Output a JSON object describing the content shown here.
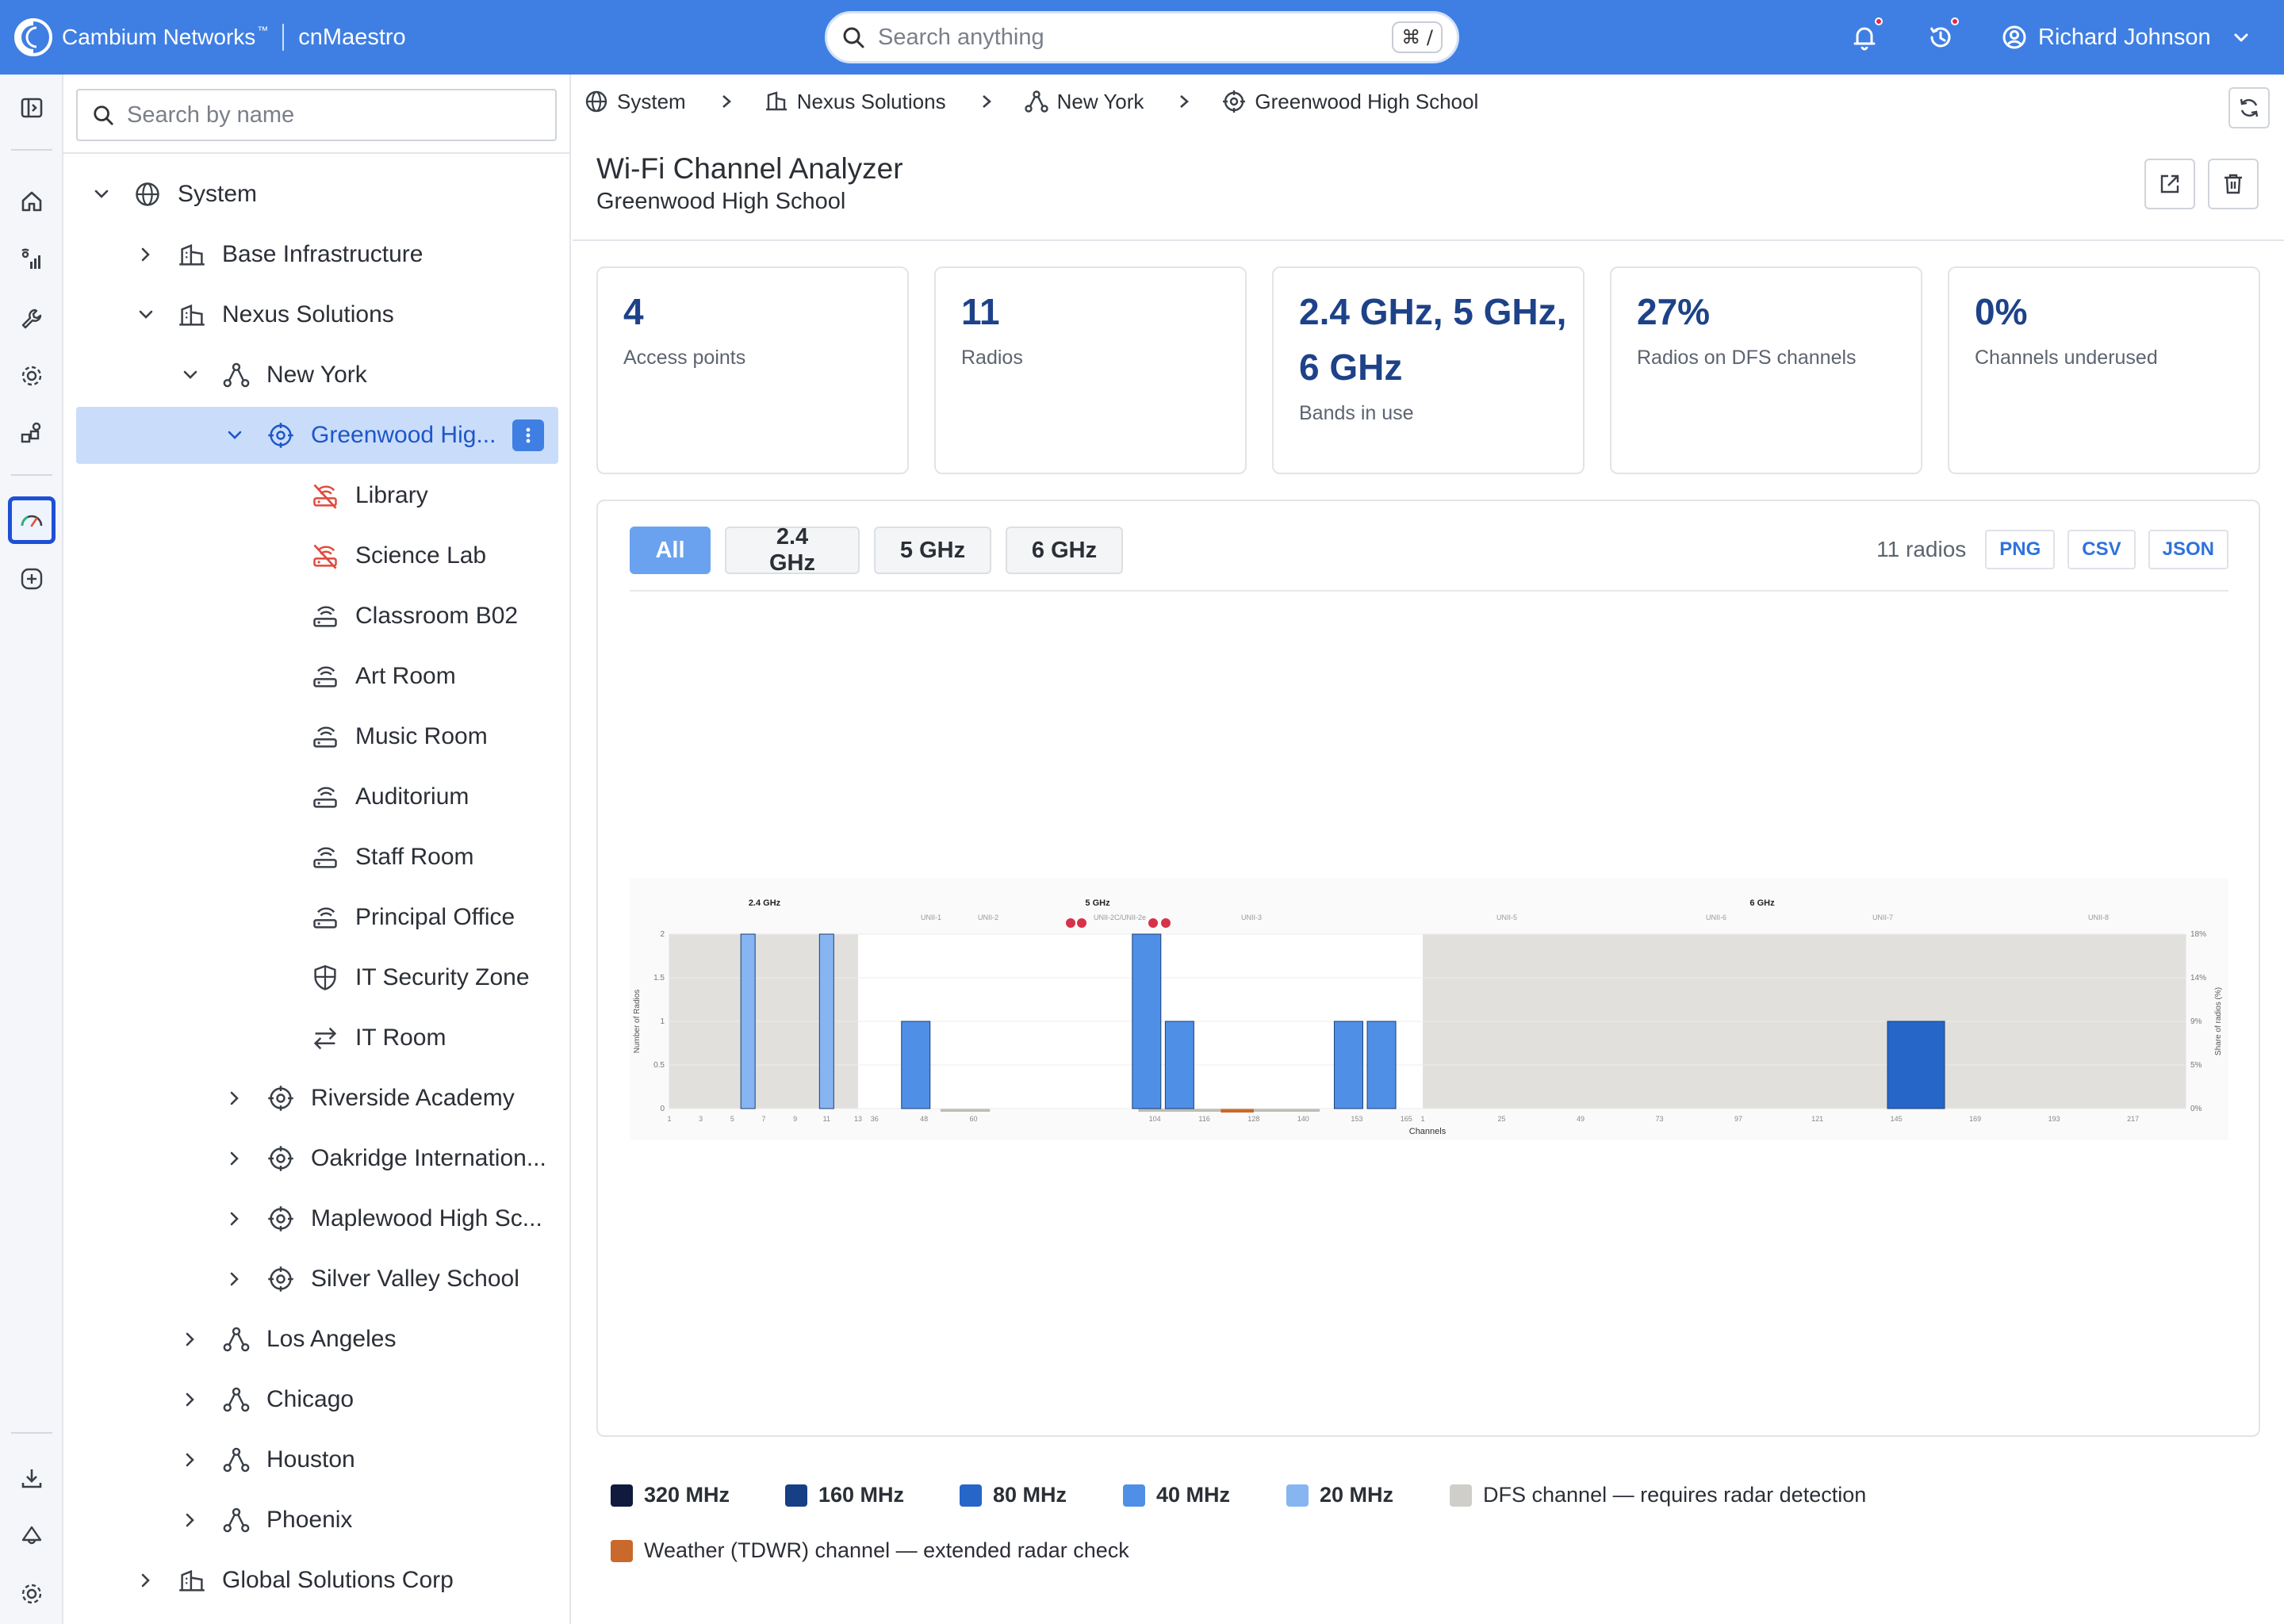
{
  "header": {
    "brand": "Cambium Networks",
    "brand_tm": "™",
    "product": "cnMaestro",
    "search_placeholder": "Search anything",
    "search_shortcut": "⌘ /",
    "user_name": "Richard Johnson"
  },
  "tree": {
    "search_placeholder": "Search by name",
    "nodes": [
      {
        "label": "System",
        "icon": "globe-icon"
      },
      {
        "label": "Base Infrastructure",
        "icon": "company-icon"
      },
      {
        "label": "Nexus Solutions",
        "icon": "company-icon"
      },
      {
        "label": "New York",
        "icon": "network-icon"
      },
      {
        "label": "Greenwood Hig...",
        "icon": "site-icon"
      },
      {
        "label": "Library",
        "icon": "ap-offline-icon"
      },
      {
        "label": "Science Lab",
        "icon": "ap-offline-icon"
      },
      {
        "label": "Classroom B02",
        "icon": "ap-icon"
      },
      {
        "label": "Art Room",
        "icon": "ap-icon"
      },
      {
        "label": "Music Room",
        "icon": "ap-icon"
      },
      {
        "label": "Auditorium",
        "icon": "ap-icon"
      },
      {
        "label": "Staff Room",
        "icon": "ap-icon"
      },
      {
        "label": "Principal Office",
        "icon": "ap-icon"
      },
      {
        "label": "IT Security Zone",
        "icon": "shield-icon"
      },
      {
        "label": "IT Room",
        "icon": "switch-icon"
      },
      {
        "label": "Riverside Academy",
        "icon": "site-icon"
      },
      {
        "label": "Oakridge Internation...",
        "icon": "site-icon"
      },
      {
        "label": "Maplewood High Sc...",
        "icon": "site-icon"
      },
      {
        "label": "Silver Valley School",
        "icon": "site-icon"
      },
      {
        "label": "Los Angeles",
        "icon": "network-icon"
      },
      {
        "label": "Chicago",
        "icon": "network-icon"
      },
      {
        "label": "Houston",
        "icon": "network-icon"
      },
      {
        "label": "Phoenix",
        "icon": "network-icon"
      },
      {
        "label": "Global Solutions Corp",
        "icon": "company-icon"
      }
    ]
  },
  "breadcrumb": [
    "System",
    "Nexus Solutions",
    "New York",
    "Greenwood High School"
  ],
  "page": {
    "title": "Wi-Fi Channel Analyzer",
    "subtitle": "Greenwood High School"
  },
  "kpis": [
    {
      "value": "4",
      "label": "Access points"
    },
    {
      "value": "11",
      "label": "Radios"
    },
    {
      "value": "2.4 GHz, 5 GHz, 6 GHz",
      "label": "Bands in use"
    },
    {
      "value": "27%",
      "label": "Radios on DFS channels"
    },
    {
      "value": "0%",
      "label": "Channels underused"
    }
  ],
  "chart_card": {
    "tabs": [
      "All",
      "2.4 GHz",
      "5 GHz",
      "6 GHz"
    ],
    "active_tab": "All",
    "radio_count": "11 radios",
    "exports": [
      "PNG",
      "CSV",
      "JSON"
    ]
  },
  "chart_data": {
    "type": "bar",
    "title": "",
    "xlabel": "Channels",
    "ylabel": "Number of Radios",
    "y2label": "Share of radios (%)",
    "ylim": [
      0,
      2
    ],
    "yticks": [
      "0",
      "0.5",
      "1",
      "1.5",
      "2"
    ],
    "y2ticks": [
      "0%",
      "5%",
      "9%",
      "14%",
      "18%"
    ],
    "bands": [
      {
        "name": "2.4 GHz",
        "sub": [],
        "ticks": [
          "1",
          "3",
          "5",
          "7",
          "9",
          "11",
          "13"
        ]
      },
      {
        "name": "5 GHz",
        "sub": [
          "UNII-1",
          "UNII-2",
          "UNII-2C/UNII-2e",
          "UNII-3"
        ],
        "ticks": [
          "36",
          "48",
          "60",
          "104",
          "116",
          "128",
          "140",
          "153",
          "165"
        ]
      },
      {
        "name": "6 GHz",
        "sub": [
          "UNII-5",
          "UNII-6",
          "UNII-7",
          "UNII-8"
        ],
        "ticks": [
          "1",
          "25",
          "49",
          "73",
          "97",
          "121",
          "145",
          "169",
          "193",
          "217"
        ]
      }
    ],
    "bars": [
      {
        "band": "2.4 GHz",
        "channel": 6,
        "width": "20 MHz",
        "count": 2
      },
      {
        "band": "2.4 GHz",
        "channel": 11,
        "width": "20 MHz",
        "count": 2
      },
      {
        "band": "5 GHz",
        "channel": 46,
        "width": "40 MHz",
        "count": 1
      },
      {
        "band": "5 GHz",
        "channel": 102,
        "width": "40 MHz",
        "count": 2
      },
      {
        "band": "5 GHz",
        "channel": 110,
        "width": "40 MHz",
        "count": 1
      },
      {
        "band": "5 GHz",
        "channel": 151,
        "width": "40 MHz",
        "count": 1
      },
      {
        "band": "5 GHz",
        "channel": 159,
        "width": "40 MHz",
        "count": 1
      },
      {
        "band": "6 GHz",
        "channel": 151,
        "width": "80 MHz",
        "count": 1
      }
    ],
    "radar_markers": [
      "5 GHz DFS",
      "5 GHz DFS",
      "5 GHz DFS",
      "5 GHz DFS"
    ]
  },
  "legend": [
    {
      "label": "320 MHz",
      "color": "#0f1a3e",
      "bold": true
    },
    {
      "label": "160 MHz",
      "color": "#173f86",
      "bold": true
    },
    {
      "label": "80 MHz",
      "color": "#2566c8",
      "bold": true
    },
    {
      "label": "40 MHz",
      "color": "#4f8fe6",
      "bold": true
    },
    {
      "label": "20 MHz",
      "color": "#86b5f1",
      "bold": true
    },
    {
      "label": "DFS channel — requires radar detection",
      "color": "#cfcec9",
      "bold": false
    },
    {
      "label": "Weather (TDWR) channel — extended radar check",
      "color": "#c9692b",
      "bold": false
    }
  ],
  "colors": {
    "accent": "#3f7fe3",
    "kpi_value": "#1d4289",
    "bar_20": "#86b5f1",
    "bar_40": "#4f8fe6",
    "bar_80": "#2566c8",
    "dfs": "#e1e0dd",
    "tdwr": "#c9692b",
    "radar": "#d6334a"
  }
}
